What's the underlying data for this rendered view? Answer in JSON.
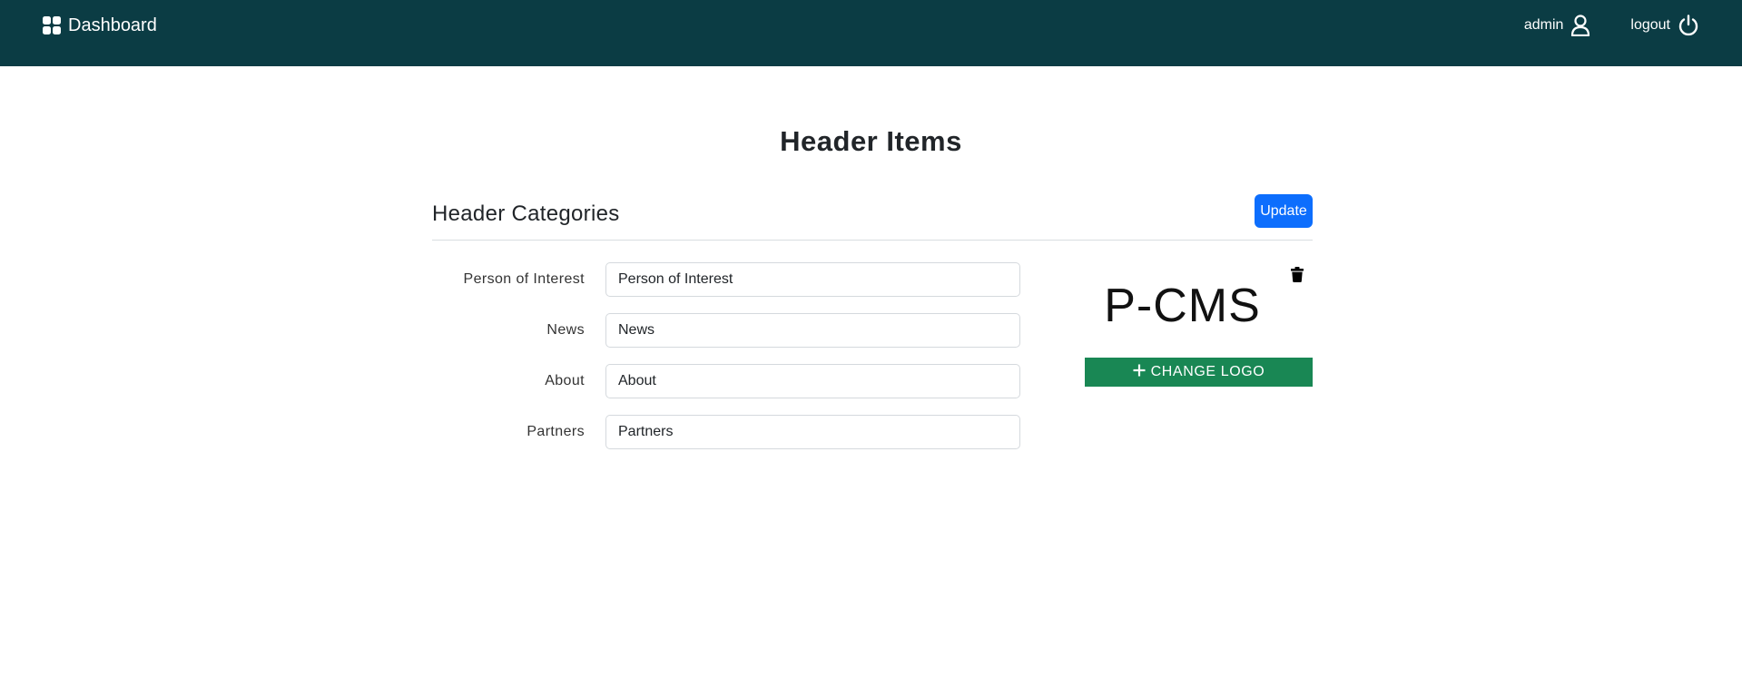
{
  "navbar": {
    "brand_label": "Dashboard",
    "brand_icon": "grid-icon",
    "user_label": "admin",
    "user_icon": "user-icon",
    "logout_label": "logout",
    "logout_icon": "power-icon",
    "background_color": "#0b3c44"
  },
  "page": {
    "title": "Header Items"
  },
  "section": {
    "title": "Header Categories",
    "update_label": "Update",
    "update_color": "#0d6efd"
  },
  "categories": [
    {
      "label": "Person of Interest",
      "value": "Person of Interest"
    },
    {
      "label": "News",
      "value": "News"
    },
    {
      "label": "About",
      "value": "About"
    },
    {
      "label": "Partners",
      "value": "Partners"
    }
  ],
  "logo": {
    "text": "P-CMS",
    "delete_icon": "trash-icon",
    "change_label": "CHANGE LOGO",
    "change_icon": "plus-icon",
    "change_color": "#198754"
  }
}
